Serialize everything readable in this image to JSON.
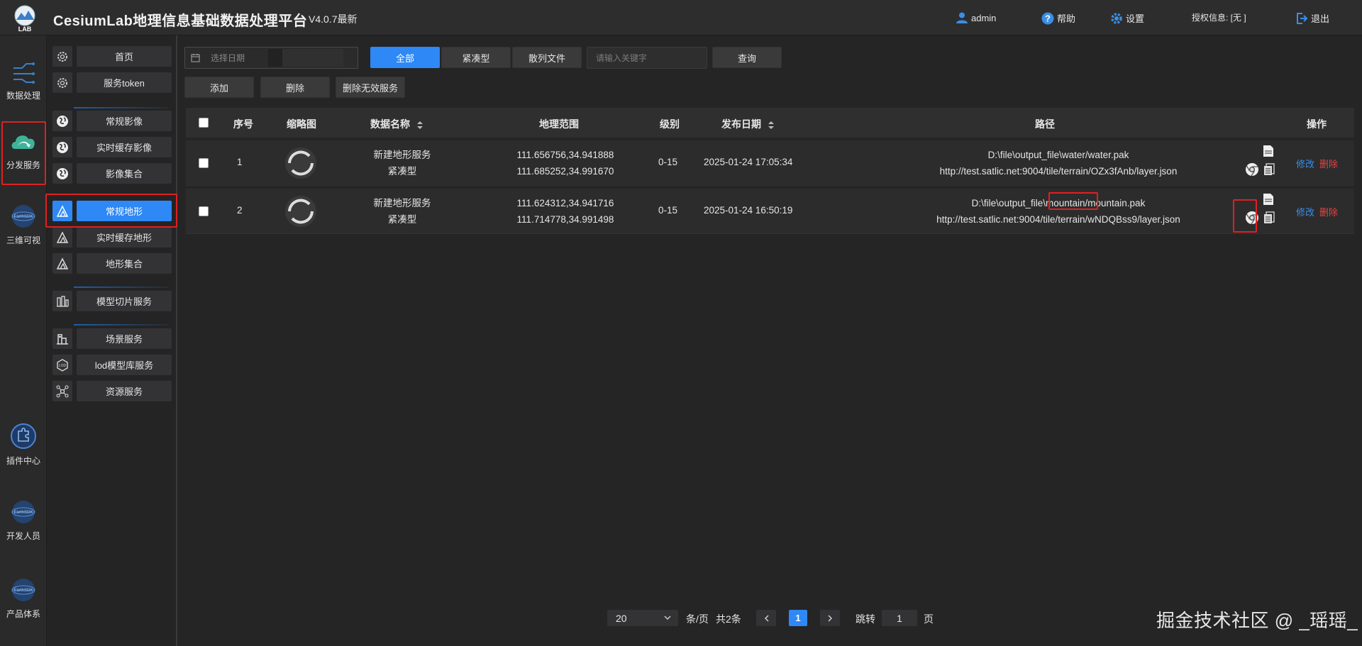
{
  "header": {
    "title": "CesiumLab地理信息基础数据处理平台",
    "version": "V4.0.7最新",
    "user": "admin",
    "help": "帮助",
    "settings": "设置",
    "license": "授权信息:  [无 ]",
    "logout": "退出",
    "logo_text": "LAB"
  },
  "rail": [
    {
      "label": "数据处理",
      "icon": "data-processing-icon"
    },
    {
      "label": "分发服务",
      "icon": "cloud-distribution-icon"
    },
    {
      "label": "三维可视",
      "icon": "earthsdk-globe-icon"
    },
    {
      "label": "插件中心",
      "icon": "plugin-icon"
    },
    {
      "label": "开发人员",
      "icon": "earthsdk-globe-icon"
    },
    {
      "label": "产品体系",
      "icon": "earthsdk-globe-icon"
    }
  ],
  "sidebar": [
    {
      "label": "首页",
      "icon": "gear-icon"
    },
    {
      "label": "服务token",
      "icon": "gear-icon"
    },
    {
      "label": "常规影像",
      "icon": "globe-icon"
    },
    {
      "label": "实时缓存影像",
      "icon": "globe-icon"
    },
    {
      "label": "影像集合",
      "icon": "globe-icon"
    },
    {
      "label": "常规地形",
      "icon": "mountain-icon"
    },
    {
      "label": "实时缓存地形",
      "icon": "mountain-icon"
    },
    {
      "label": "地形集合",
      "icon": "mountain-icon"
    },
    {
      "label": "模型切片服务",
      "icon": "model-icon"
    },
    {
      "label": "场景服务",
      "icon": "scene-icon"
    },
    {
      "label": "lod模型库服务",
      "icon": "lod-icon"
    },
    {
      "label": "资源服务",
      "icon": "network-icon"
    }
  ],
  "toolbar": {
    "date_placeholder": "选择日期",
    "filters": [
      "全部",
      "紧凑型",
      "散列文件"
    ],
    "keyword_placeholder": "请输入关键字",
    "query": "查询",
    "add": "添加",
    "delete": "删除",
    "delete_invalid": "删除无效服务"
  },
  "table": {
    "columns": [
      "序号",
      "缩略图",
      "数据名称",
      "地理范围",
      "级别",
      "发布日期",
      "路径",
      "操作"
    ],
    "rows": [
      {
        "index": "1",
        "name": "新建地形服务",
        "type": "紧凑型",
        "extent1": "111.656756,34.941888",
        "extent2": "111.685252,34.991670",
        "level": "0-15",
        "date": "2025-01-24 17:05:34",
        "path": "D:\\file\\output_file\\water/water.pak",
        "url": "http://test.satlic.net:9004/tile/terrain/OZx3fAnb/layer.json",
        "edit": "修改",
        "del": "删除"
      },
      {
        "index": "2",
        "name": "新建地形服务",
        "type": "紧凑型",
        "extent1": "111.624312,34.941716",
        "extent2": "111.714778,34.991498",
        "level": "0-15",
        "date": "2025-01-24 16:50:19",
        "path": "D:\\file\\output_file\\mountain/mountain.pak",
        "url": "http://test.satlic.net:9004/tile/terrain/wNDQBss9/layer.json",
        "edit": "修改",
        "del": "删除"
      }
    ]
  },
  "pagination": {
    "page_size": "20",
    "per_page": "条/页",
    "total": "共2条",
    "current": "1",
    "jump": "跳转",
    "jump_value": "1",
    "page": "页"
  },
  "watermark": "掘金技术社区 @ _瑶瑶_",
  "colors": {
    "accent": "#2e88f5",
    "danger": "#e04545",
    "highlight": "#e02020"
  }
}
